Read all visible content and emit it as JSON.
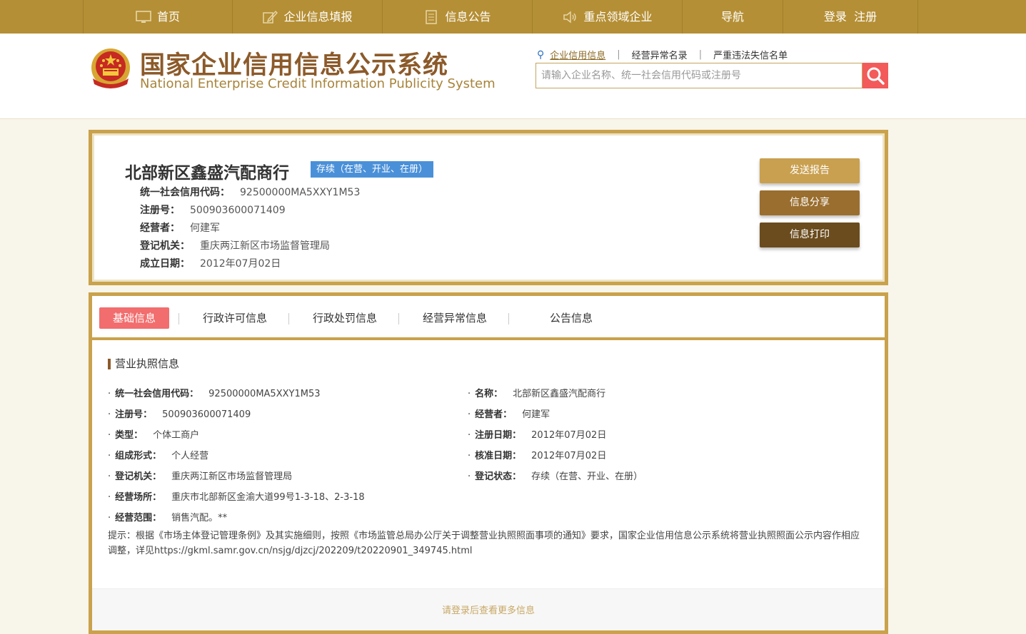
{
  "nav": {
    "items": [
      {
        "label": "首页",
        "icon": "monitor-icon"
      },
      {
        "label": "企业信息填报",
        "icon": "edit-icon"
      },
      {
        "label": "信息公告",
        "icon": "document-icon"
      },
      {
        "label": "重点领域企业",
        "icon": "speaker-icon"
      },
      {
        "label": "导航",
        "icon": ""
      },
      {
        "label": "登录  注册",
        "icon": ""
      }
    ]
  },
  "header": {
    "title": "国家企业信用信息公示系统",
    "subtitle": "National Enterprise Credit Information Publicity System",
    "search_links": [
      "企业信用信息",
      "经营异常名录",
      "严重违法失信名单"
    ],
    "search_placeholder": "请输入企业名称、统一社会信用代码或注册号"
  },
  "company": {
    "name": "北部新区鑫盛汽配商行",
    "status": "存续（在营、开业、在册）",
    "fields": [
      {
        "label": "统一社会信用代码：",
        "value": "92500000MA5XXY1M53"
      },
      {
        "label": "注册号：",
        "value": "500903600071409"
      },
      {
        "label": "经营者：",
        "value": "何建军"
      },
      {
        "label": "登记机关：",
        "value": "重庆两江新区市场监督管理局"
      },
      {
        "label": "成立日期：",
        "value": "2012年07月02日"
      }
    ],
    "buttons": {
      "send": "发送报告",
      "share": "信息分享",
      "print": "信息打印"
    }
  },
  "tabs": [
    "基础信息",
    "行政许可信息",
    "行政处罚信息",
    "经营异常信息",
    "公告信息"
  ],
  "license": {
    "section_title": "营业执照信息",
    "left": [
      {
        "label": "统一社会信用代码：",
        "value": "92500000MA5XXY1M53"
      },
      {
        "label": "注册号：",
        "value": "500903600071409"
      },
      {
        "label": "类型：",
        "value": "个体工商户"
      },
      {
        "label": "组成形式：",
        "value": "个人经营"
      },
      {
        "label": "登记机关：",
        "value": "重庆两江新区市场监督管理局"
      },
      {
        "label": "经营场所：",
        "value": "重庆市北部新区金渝大道99号1-3-18、2-3-18"
      },
      {
        "label": "经营范围：",
        "value": "销售汽配。**"
      }
    ],
    "right": [
      {
        "label": "名称：",
        "value": "北部新区鑫盛汽配商行"
      },
      {
        "label": "经营者：",
        "value": "何建军"
      },
      {
        "label": "注册日期：",
        "value": "2012年07月02日"
      },
      {
        "label": "核准日期：",
        "value": "2012年07月02日"
      },
      {
        "label": "登记状态：",
        "value": "存续（在营、开业、在册）"
      }
    ],
    "note": "提示：根据《市场主体登记管理条例》及其实施细则，按照《市场监管总局办公厅关于调整营业执照照面事项的通知》要求，国家企业信用信息公示系统将营业执照照面公示内容作相应调整，详见https://gkml.samr.gov.cn/nsjg/djzcj/202209/t20220901_349745.html"
  },
  "footer": {
    "login_hint": "请登录后查看更多信息"
  },
  "colors": {
    "nav_bg": "#b58f35",
    "border_gold": "#c9a24b",
    "badge_blue": "#4a90d9",
    "tab_active": "#f26d6d",
    "search_btn": "#f35a5a"
  }
}
